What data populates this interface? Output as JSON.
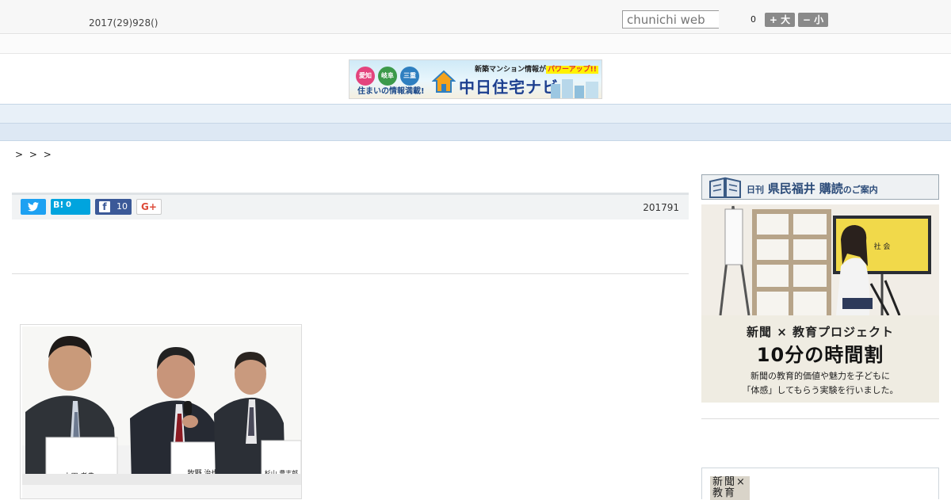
{
  "header": {
    "date": "2017(29)928()",
    "search_placeholder": "chunichi web",
    "font_size_count": "0",
    "font_larger_label": "+ 大",
    "font_smaller_label": "− 小"
  },
  "banner": {
    "regions": [
      "愛知",
      "岐阜",
      "三重"
    ],
    "sub_text": "住まいの情報満載!",
    "top_text_prefix": "新築マンション情報が",
    "top_text_highlight": "パワーアップ!!",
    "brand": "中日住宅ナビ"
  },
  "nav": {
    "items": [
      "",
      "",
      "",
      "",
      "",
      "",
      "",
      "",
      ""
    ]
  },
  "breadcrumb": "> > >",
  "article": {
    "share": {
      "hatena_label": "B!",
      "hatena_count": "0",
      "facebook_label": "f",
      "facebook_count": "10",
      "gplus_label": "G+"
    },
    "pub_date": "201791",
    "photo": {
      "nameplates": [
        "上田 孝典",
        "牧野 治也",
        "杉山 豊志郎"
      ]
    }
  },
  "sidebar": {
    "subscribe": {
      "prefix": "日刊",
      "paper": "県民福井",
      "action": "購読",
      "suffix": "のご案内"
    },
    "ad": {
      "board_label": "社 会",
      "line1": "新聞 × 教育プロジェクト",
      "line2": "10分の時間割",
      "line3": "新聞の教育的価値や魅力を子どもに",
      "line4": "「体感」してもらう実験を行いました。"
    },
    "box2_logo": "新聞×教育"
  },
  "colors": {
    "twitter": "#1da1f2",
    "hatena": "#00a4de",
    "facebook": "#3b5998",
    "nav_bg": "#e8f0f8"
  }
}
